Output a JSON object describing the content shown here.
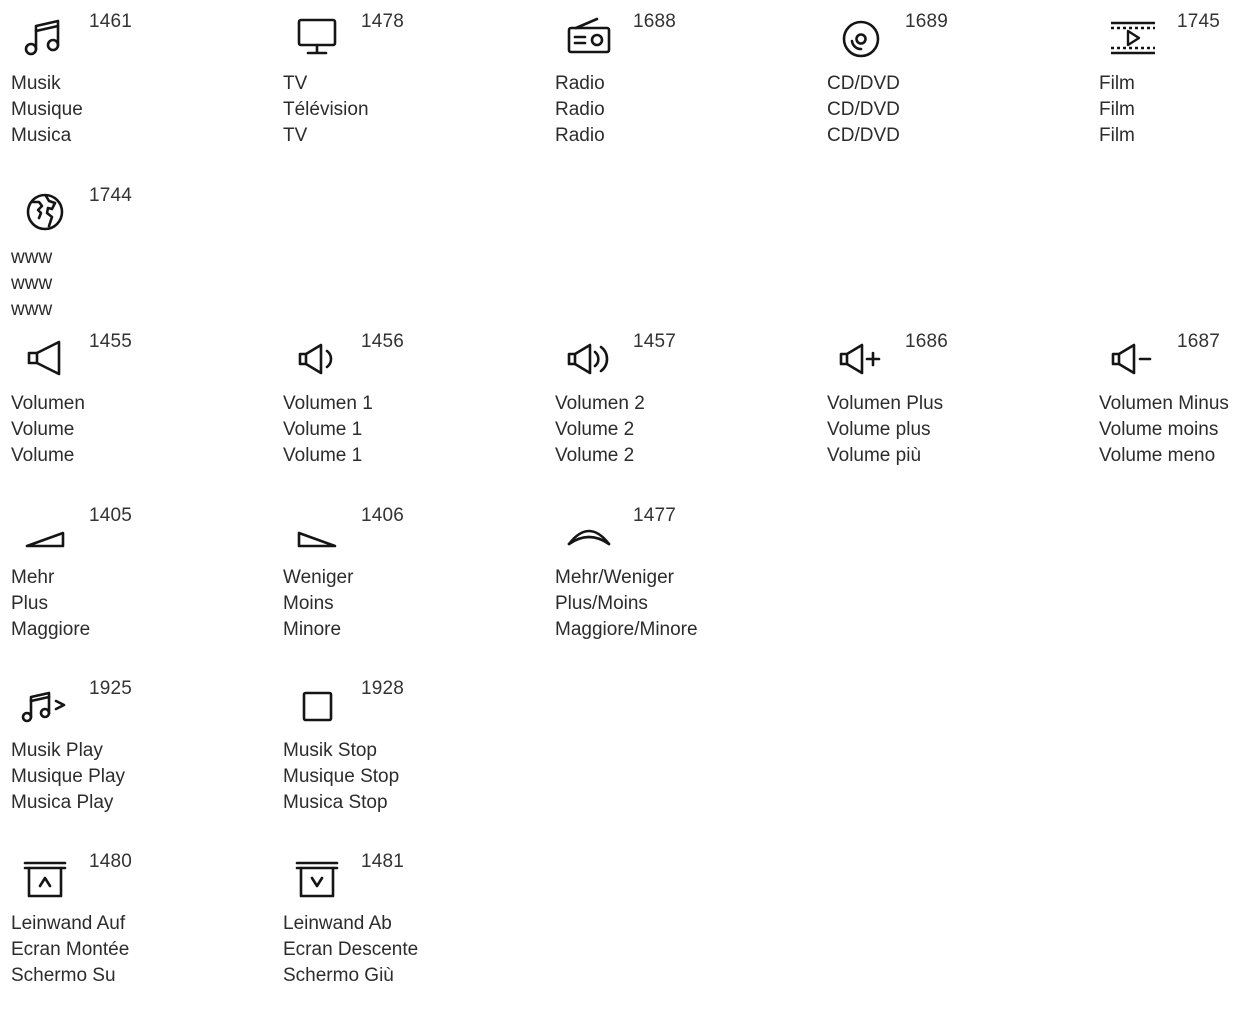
{
  "colors": {
    "ink": "#151515",
    "text": "#2c2c2c",
    "background": "#ffffff"
  },
  "icons": [
    {
      "code": "1461",
      "icon": "music-note-icon",
      "labels": [
        "Musik",
        "Musique",
        "Musica"
      ]
    },
    {
      "code": "1478",
      "icon": "tv-monitor-icon",
      "labels": [
        "TV",
        "Télévision",
        "TV"
      ]
    },
    {
      "code": "1688",
      "icon": "radio-icon",
      "labels": [
        "Radio",
        "Radio",
        "Radio"
      ]
    },
    {
      "code": "1689",
      "icon": "cd-dvd-icon",
      "labels": [
        "CD/DVD",
        "CD/DVD",
        "CD/DVD"
      ]
    },
    {
      "code": "1745",
      "icon": "film-icon",
      "labels": [
        "Film",
        "Film",
        "Film"
      ]
    },
    {
      "code": "1744",
      "icon": "globe-www-icon",
      "labels": [
        "www",
        "www",
        "www"
      ]
    },
    {
      "code": "1455",
      "icon": "speaker-icon",
      "labels": [
        "Volumen",
        "Volume",
        "Volume"
      ]
    },
    {
      "code": "1456",
      "icon": "speaker-wave1-icon",
      "labels": [
        "Volumen 1",
        "Volume 1",
        "Volume 1"
      ]
    },
    {
      "code": "1457",
      "icon": "speaker-wave2-icon",
      "labels": [
        "Volumen 2",
        "Volume 2",
        "Volume 2"
      ]
    },
    {
      "code": "1686",
      "icon": "speaker-plus-icon",
      "labels": [
        "Volumen Plus",
        "Volume plus",
        "Volume più"
      ]
    },
    {
      "code": "1687",
      "icon": "speaker-minus-icon",
      "labels": [
        "Volumen Minus",
        "Volume moins",
        "Volume meno"
      ]
    },
    {
      "code": "1405",
      "icon": "ramp-up-icon",
      "labels": [
        "Mehr",
        "Plus",
        "Maggiore"
      ]
    },
    {
      "code": "1406",
      "icon": "ramp-down-icon",
      "labels": [
        "Weniger",
        "Moins",
        "Minore"
      ]
    },
    {
      "code": "1477",
      "icon": "arc-icon",
      "labels": [
        "Mehr/Weniger",
        "Plus/Moins",
        "Maggiore/Minore"
      ]
    },
    {
      "code": "1925",
      "icon": "music-play-icon",
      "labels": [
        "Musik Play",
        "Musique Play",
        "Musica Play"
      ]
    },
    {
      "code": "1928",
      "icon": "stop-square-icon",
      "labels": [
        "Musik Stop",
        "Musique Stop",
        "Musica Stop"
      ]
    },
    {
      "code": "1480",
      "icon": "screen-up-icon",
      "labels": [
        "Leinwand Auf",
        "Ecran Montée",
        "Schermo Su"
      ]
    },
    {
      "code": "1481",
      "icon": "screen-down-icon",
      "labels": [
        "Leinwand Ab",
        "Ecran Descente",
        "Schermo Giù"
      ]
    }
  ]
}
